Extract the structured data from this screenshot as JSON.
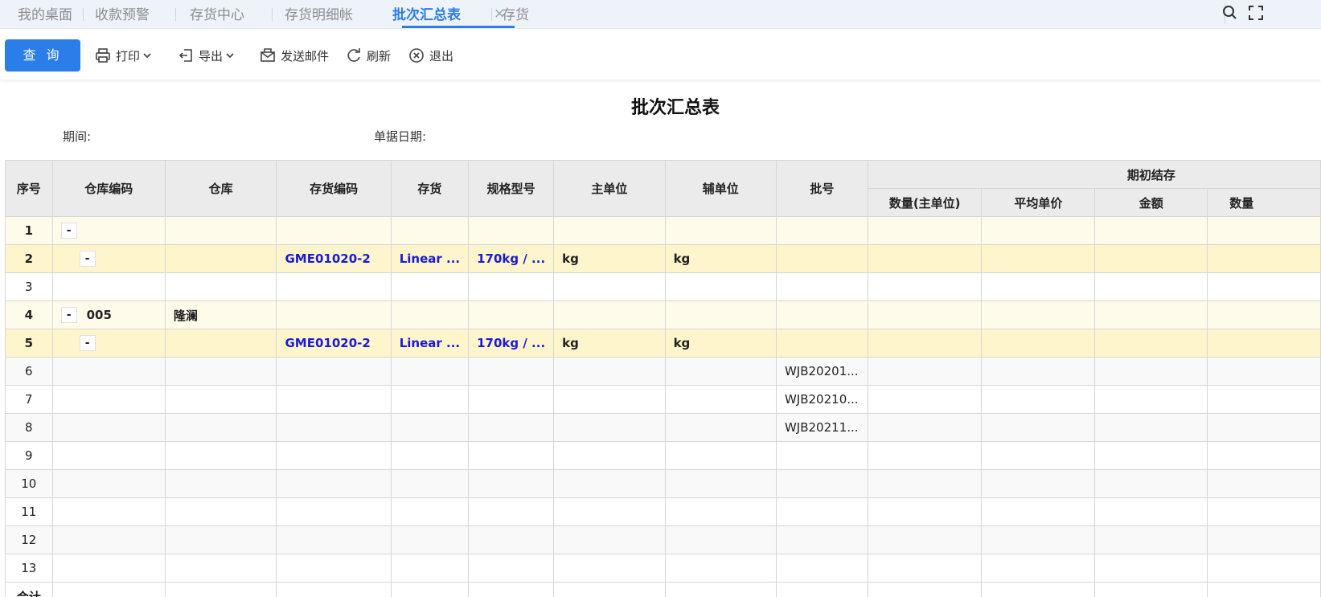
{
  "tabs": [
    {
      "label": "我的桌面"
    },
    {
      "label": "收款预警"
    },
    {
      "label": "存货中心"
    },
    {
      "label": "存货明细帐"
    },
    {
      "label": "批次汇总表"
    },
    {
      "label": "存货"
    }
  ],
  "tab_close_glyph": "×",
  "toolbar": {
    "query_label": "查 询",
    "print_label": "打印",
    "export_label": "导出",
    "email_label": "发送邮件",
    "refresh_label": "刷新",
    "exit_label": "退出"
  },
  "report": {
    "title": "批次汇总表",
    "period_label": "期间:",
    "date_label": "单据日期:"
  },
  "table": {
    "headers": {
      "seq": "序号",
      "wh_code": "仓库编码",
      "warehouse": "仓库",
      "item_code": "存货编码",
      "item": "存货",
      "spec": "规格型号",
      "main_unit": "主单位",
      "aux_unit": "辅单位",
      "lot": "批号",
      "group_opening": "期初结存",
      "qty_main": "数量(主单位)",
      "avg_price": "平均单价",
      "amount": "金额",
      "qty_aux": "数量"
    },
    "rows": [
      {
        "seq": "1",
        "toggle": "-",
        "wh_code": "",
        "warehouse": "",
        "item_code": "",
        "item": "",
        "spec": "",
        "main_unit": "",
        "aux_unit": "",
        "lot": ""
      },
      {
        "seq": "2",
        "toggle": "-",
        "wh_code": "",
        "warehouse": "",
        "item_code": "GME01020-2",
        "item": "Linear ...",
        "spec": "170kg / ...",
        "main_unit": "kg",
        "aux_unit": "kg",
        "lot": ""
      },
      {
        "seq": "3",
        "toggle": "",
        "wh_code": "",
        "warehouse": "",
        "item_code": "",
        "item": "",
        "spec": "",
        "main_unit": "",
        "aux_unit": "",
        "lot": ""
      },
      {
        "seq": "4",
        "toggle": "-",
        "wh_code": "005",
        "warehouse": "隆澜",
        "item_code": "",
        "item": "",
        "spec": "",
        "main_unit": "",
        "aux_unit": "",
        "lot": ""
      },
      {
        "seq": "5",
        "toggle": "-",
        "wh_code": "",
        "warehouse": "",
        "item_code": "GME01020-2",
        "item": "Linear ...",
        "spec": "170kg / ...",
        "main_unit": "kg",
        "aux_unit": "kg",
        "lot": ""
      },
      {
        "seq": "6",
        "toggle": "",
        "wh_code": "",
        "warehouse": "",
        "item_code": "",
        "item": "",
        "spec": "",
        "main_unit": "",
        "aux_unit": "",
        "lot": "WJB20201..."
      },
      {
        "seq": "7",
        "toggle": "",
        "wh_code": "",
        "warehouse": "",
        "item_code": "",
        "item": "",
        "spec": "",
        "main_unit": "",
        "aux_unit": "",
        "lot": "WJB20210..."
      },
      {
        "seq": "8",
        "toggle": "",
        "wh_code": "",
        "warehouse": "",
        "item_code": "",
        "item": "",
        "spec": "",
        "main_unit": "",
        "aux_unit": "",
        "lot": "WJB20211..."
      },
      {
        "seq": "9",
        "toggle": "",
        "wh_code": "",
        "warehouse": "",
        "item_code": "",
        "item": "",
        "spec": "",
        "main_unit": "",
        "aux_unit": "",
        "lot": ""
      },
      {
        "seq": "10",
        "toggle": "",
        "wh_code": "",
        "warehouse": "",
        "item_code": "",
        "item": "",
        "spec": "",
        "main_unit": "",
        "aux_unit": "",
        "lot": ""
      },
      {
        "seq": "11",
        "toggle": "",
        "wh_code": "",
        "warehouse": "",
        "item_code": "",
        "item": "",
        "spec": "",
        "main_unit": "",
        "aux_unit": "",
        "lot": ""
      },
      {
        "seq": "12",
        "toggle": "",
        "wh_code": "",
        "warehouse": "",
        "item_code": "",
        "item": "",
        "spec": "",
        "main_unit": "",
        "aux_unit": "",
        "lot": ""
      },
      {
        "seq": "13",
        "toggle": "",
        "wh_code": "",
        "warehouse": "",
        "item_code": "",
        "item": "",
        "spec": "",
        "main_unit": "",
        "aux_unit": "",
        "lot": ""
      }
    ],
    "total_label": "合计"
  },
  "colors": {
    "accent": "#2b7de9",
    "link_text": "#1a1ad6",
    "group_row_bg": "#fffbea",
    "item_row_bg": "#fff5cc"
  }
}
